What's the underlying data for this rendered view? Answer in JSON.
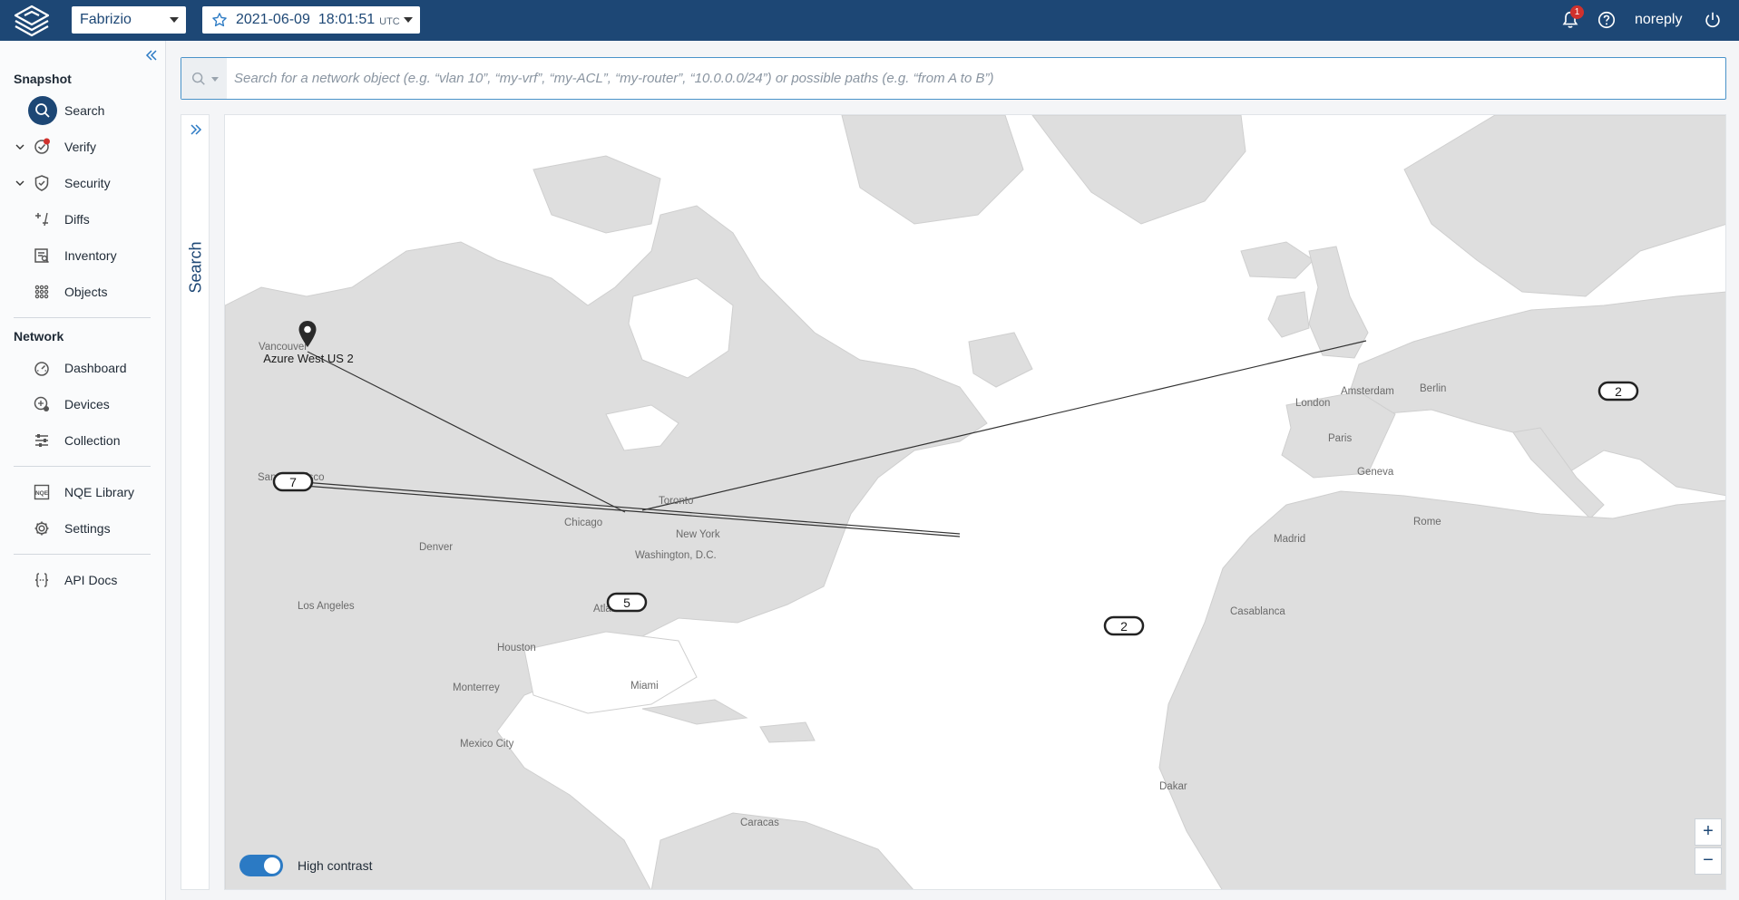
{
  "topbar": {
    "network_name": "Fabrizio",
    "snapshot_date": "2021-06-09",
    "snapshot_time": "18:01:51",
    "snapshot_tz": "UTC",
    "notification_count": "1",
    "username": "noreply"
  },
  "sidebar": {
    "snapshot_title": "Snapshot",
    "network_title": "Network",
    "items": {
      "search": "Search",
      "verify": "Verify",
      "security": "Security",
      "diffs": "Diffs",
      "inventory": "Inventory",
      "objects": "Objects",
      "dashboard": "Dashboard",
      "devices": "Devices",
      "collection": "Collection",
      "nqe_library": "NQE Library",
      "settings": "Settings",
      "api_docs": "API Docs"
    }
  },
  "search": {
    "placeholder": "Search for a network object (e.g. “vlan 10”, “my-vrf”, “my-ACL”, “my-router”, “10.0.0.0/24”) or possible paths (e.g. “from A to B”)",
    "tab_label": "Search"
  },
  "map": {
    "cities": {
      "vancouver": "Vancouver",
      "san_francisco": "San Francisco",
      "los_angeles": "Los Angeles",
      "denver": "Denver",
      "chicago": "Chicago",
      "toronto": "Toronto",
      "new_york": "New York",
      "washington": "Washington, D.C.",
      "atlanta": "Atlanta",
      "houston": "Houston",
      "monterrey": "Monterrey",
      "miami": "Miami",
      "mexico_city": "Mexico City",
      "caracas": "Caracas",
      "london": "London",
      "amsterdam": "Amsterdam",
      "berlin": "Berlin",
      "paris": "Paris",
      "geneva": "Geneva",
      "madrid": "Madrid",
      "rome": "Rome",
      "casablanca": "Casablanca",
      "dakar": "Dakar"
    },
    "pin_label": "Azure West US 2",
    "clusters": {
      "sf": "7",
      "atlanta": "5",
      "atlantic": "2",
      "paris": "2"
    },
    "high_contrast_label": "High contrast",
    "high_contrast_on": true,
    "zoom_in": "+",
    "zoom_out": "−"
  }
}
